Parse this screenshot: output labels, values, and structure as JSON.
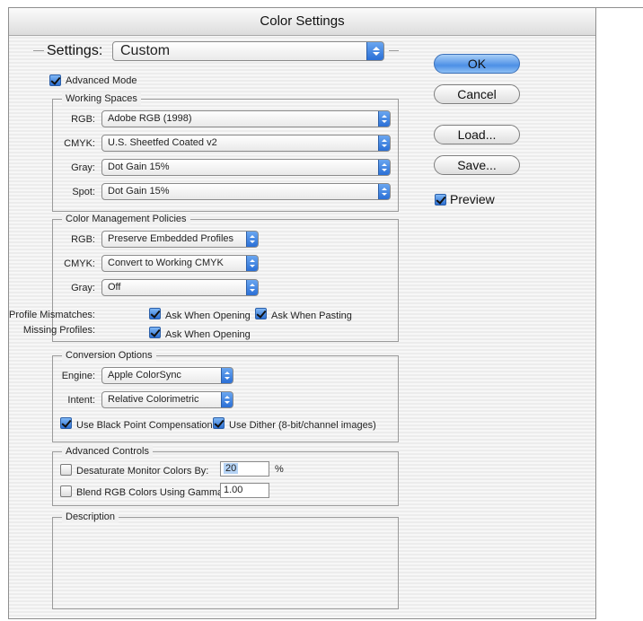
{
  "window": {
    "title": "Color Settings"
  },
  "settings": {
    "label": "Settings:",
    "value": "Custom",
    "advanced_mode": "Advanced Mode"
  },
  "buttons": {
    "ok": "OK",
    "cancel": "Cancel",
    "load": "Load...",
    "save": "Save...",
    "preview": "Preview"
  },
  "working_spaces": {
    "legend": "Working Spaces",
    "rgb_label": "RGB:",
    "rgb": "Adobe RGB (1998)",
    "cmyk_label": "CMYK:",
    "cmyk": "U.S. Sheetfed Coated v2",
    "gray_label": "Gray:",
    "gray": "Dot Gain 15%",
    "spot_label": "Spot:",
    "spot": "Dot Gain 15%"
  },
  "policies": {
    "legend": "Color Management Policies",
    "rgb_label": "RGB:",
    "rgb": "Preserve Embedded Profiles",
    "cmyk_label": "CMYK:",
    "cmyk": "Convert to Working CMYK",
    "gray_label": "Gray:",
    "gray": "Off",
    "mismatch_label": "Profile Mismatches:",
    "ask_opening": "Ask When Opening",
    "ask_pasting": "Ask When Pasting",
    "missing_label": "Missing Profiles:",
    "missing_ask_opening": "Ask When Opening"
  },
  "conversion": {
    "legend": "Conversion Options",
    "engine_label": "Engine:",
    "engine": "Apple ColorSync",
    "intent_label": "Intent:",
    "intent": "Relative Colorimetric",
    "bpc": "Use Black Point Compensation",
    "dither": "Use Dither (8-bit/channel images)"
  },
  "advanced": {
    "legend": "Advanced Controls",
    "desaturate": "Desaturate Monitor Colors By:",
    "desaturate_value": "20",
    "percent": "%",
    "blend": "Blend RGB Colors Using Gamma:",
    "blend_value": "1.00"
  },
  "description": {
    "legend": "Description"
  },
  "states": {
    "advanced_mode": true,
    "preview": true,
    "ask_opening": true,
    "ask_pasting": true,
    "missing_ask_opening": true,
    "bpc": true,
    "dither": true,
    "desaturate": false,
    "blend": false
  },
  "colors": {
    "accent": "#2c6fd2",
    "background": "#ececec"
  }
}
